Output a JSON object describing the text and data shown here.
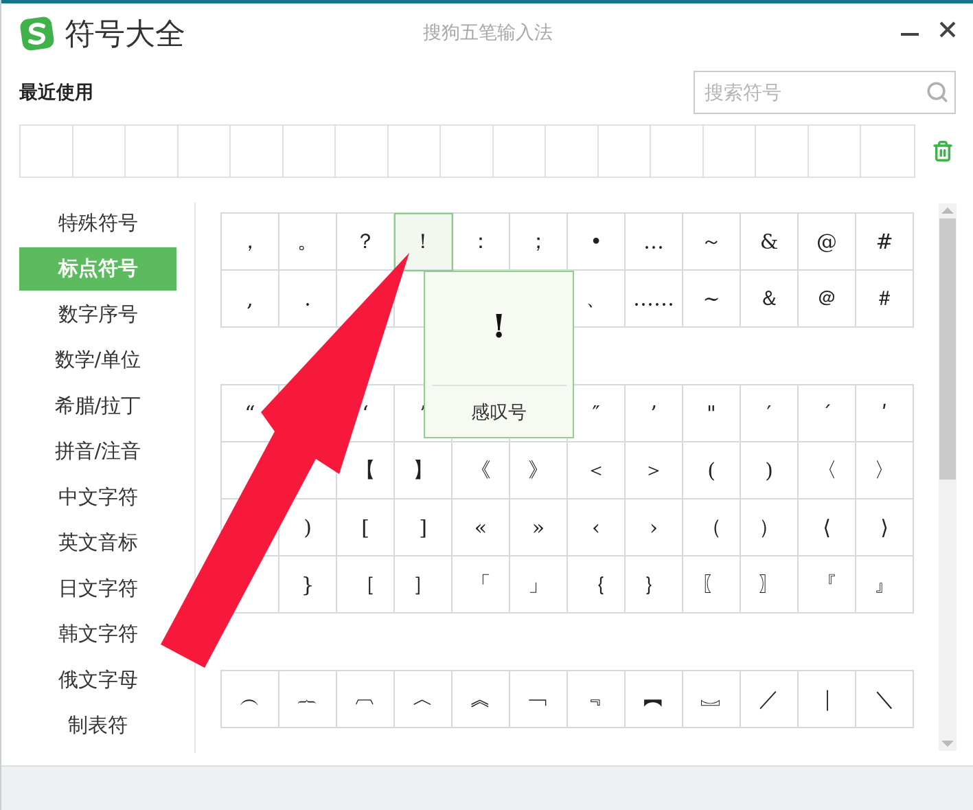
{
  "window": {
    "title": "符号大全",
    "subtitle": "搜狗五笔输入法"
  },
  "recent": {
    "label": "最近使用"
  },
  "search": {
    "placeholder": "搜索符号"
  },
  "categories": [
    {
      "label": "特殊符号",
      "selected": false
    },
    {
      "label": "标点符号",
      "selected": true
    },
    {
      "label": "数字序号",
      "selected": false
    },
    {
      "label": "数学/单位",
      "selected": false
    },
    {
      "label": "希腊/拉丁",
      "selected": false
    },
    {
      "label": "拼音/注音",
      "selected": false
    },
    {
      "label": "中文字符",
      "selected": false
    },
    {
      "label": "英文音标",
      "selected": false
    },
    {
      "label": "日文字符",
      "selected": false
    },
    {
      "label": "韩文字符",
      "selected": false
    },
    {
      "label": "俄文字母",
      "selected": false
    },
    {
      "label": "制表符",
      "selected": false
    }
  ],
  "symbol_groups": [
    {
      "rows": [
        [
          {
            "symbol": "，",
            "selected": false
          },
          {
            "symbol": "。",
            "selected": false
          },
          {
            "symbol": "？",
            "selected": false
          },
          {
            "symbol": "！",
            "selected": true
          },
          {
            "symbol": "：",
            "selected": false
          },
          {
            "symbol": "；",
            "selected": false
          },
          {
            "symbol": "•",
            "selected": false
          },
          {
            "symbol": "…",
            "selected": false
          },
          {
            "symbol": "～",
            "selected": false
          },
          {
            "symbol": "&",
            "selected": false
          },
          {
            "symbol": "@",
            "selected": false
          },
          {
            "symbol": "#",
            "selected": false
          }
        ],
        [
          {
            "symbol": ",",
            "selected": false
          },
          {
            "symbol": ".",
            "selected": false
          },
          {
            "selected": false
          },
          {
            "selected": false
          },
          {},
          {},
          {
            "symbol": "、",
            "selected": false
          },
          {
            "symbol": "……",
            "selected": false
          },
          {
            "symbol": "∼",
            "selected": false
          },
          {
            "symbol": "＆",
            "selected": false
          },
          {
            "symbol": "＠",
            "selected": false
          },
          {
            "symbol": "＃",
            "selected": false
          }
        ]
      ]
    },
    {
      "rows": [
        [
          {
            "symbol": "“",
            "selected": false
          },
          {},
          {
            "symbol": "‘",
            "selected": false
          },
          {
            "symbol": "’",
            "selected": false
          },
          {},
          {},
          {
            "symbol": "″",
            "selected": false
          },
          {
            "symbol": "’",
            "selected": false
          },
          {
            "symbol": "\"",
            "selected": false
          },
          {
            "symbol": "′",
            "selected": false
          },
          {
            "symbol": "ˊ",
            "selected": false
          },
          {
            "symbol": "ʹ",
            "selected": false
          }
        ],
        [
          {
            "selected": false
          },
          {
            "selected": false
          },
          {
            "symbol": "【",
            "selected": false
          },
          {
            "symbol": "】",
            "selected": false
          },
          {
            "symbol": "《",
            "selected": false
          },
          {
            "symbol": "》",
            "selected": false
          },
          {
            "symbol": "＜",
            "selected": false
          },
          {
            "symbol": "＞",
            "selected": false
          },
          {
            "symbol": "(",
            "selected": false
          },
          {
            "symbol": ")",
            "selected": false
          },
          {
            "symbol": "〈",
            "selected": false
          },
          {
            "symbol": "〉",
            "selected": false
          }
        ],
        [
          {
            "selected": false
          },
          {
            "symbol": ")",
            "selected": false
          },
          {
            "symbol": "[",
            "selected": false
          },
          {
            "symbol": "]",
            "selected": false
          },
          {
            "symbol": "«",
            "selected": false
          },
          {
            "symbol": "»",
            "selected": false
          },
          {
            "symbol": "‹",
            "selected": false
          },
          {
            "symbol": "›",
            "selected": false
          },
          {
            "symbol": "（",
            "selected": false
          },
          {
            "symbol": "）",
            "selected": false
          },
          {
            "symbol": "⟨",
            "selected": false
          },
          {
            "symbol": "⟩",
            "selected": false
          }
        ],
        [
          {
            "selected": false
          },
          {
            "symbol": "}",
            "selected": false
          },
          {
            "symbol": "［",
            "selected": false
          },
          {
            "symbol": "］",
            "selected": false
          },
          {
            "symbol": "「",
            "selected": false
          },
          {
            "symbol": "」",
            "selected": false
          },
          {
            "symbol": "｛",
            "selected": false
          },
          {
            "symbol": "｝",
            "selected": false
          },
          {
            "symbol": "〖",
            "selected": false
          },
          {
            "symbol": "〗",
            "selected": false
          },
          {
            "symbol": "『",
            "selected": false
          },
          {
            "symbol": "』",
            "selected": false
          }
        ]
      ]
    },
    {
      "rows": [
        [
          {
            "symbol": "︵",
            "selected": false
          },
          {
            "symbol": "︷",
            "selected": false
          },
          {
            "symbol": "︹",
            "selected": false
          },
          {
            "symbol": "︿",
            "selected": false
          },
          {
            "symbol": "︽",
            "selected": false
          },
          {
            "symbol": "﹁",
            "selected": false
          },
          {
            "symbol": "﹃",
            "selected": false
          },
          {
            "symbol": "︻",
            "selected": false
          },
          {
            "symbol": "︗",
            "selected": false
          },
          {
            "symbol": "／",
            "selected": false
          },
          {
            "symbol": "｜",
            "selected": false
          },
          {
            "symbol": "＼",
            "selected": false
          }
        ]
      ]
    }
  ],
  "tooltip": {
    "symbol": "!",
    "name": "感叹号"
  }
}
